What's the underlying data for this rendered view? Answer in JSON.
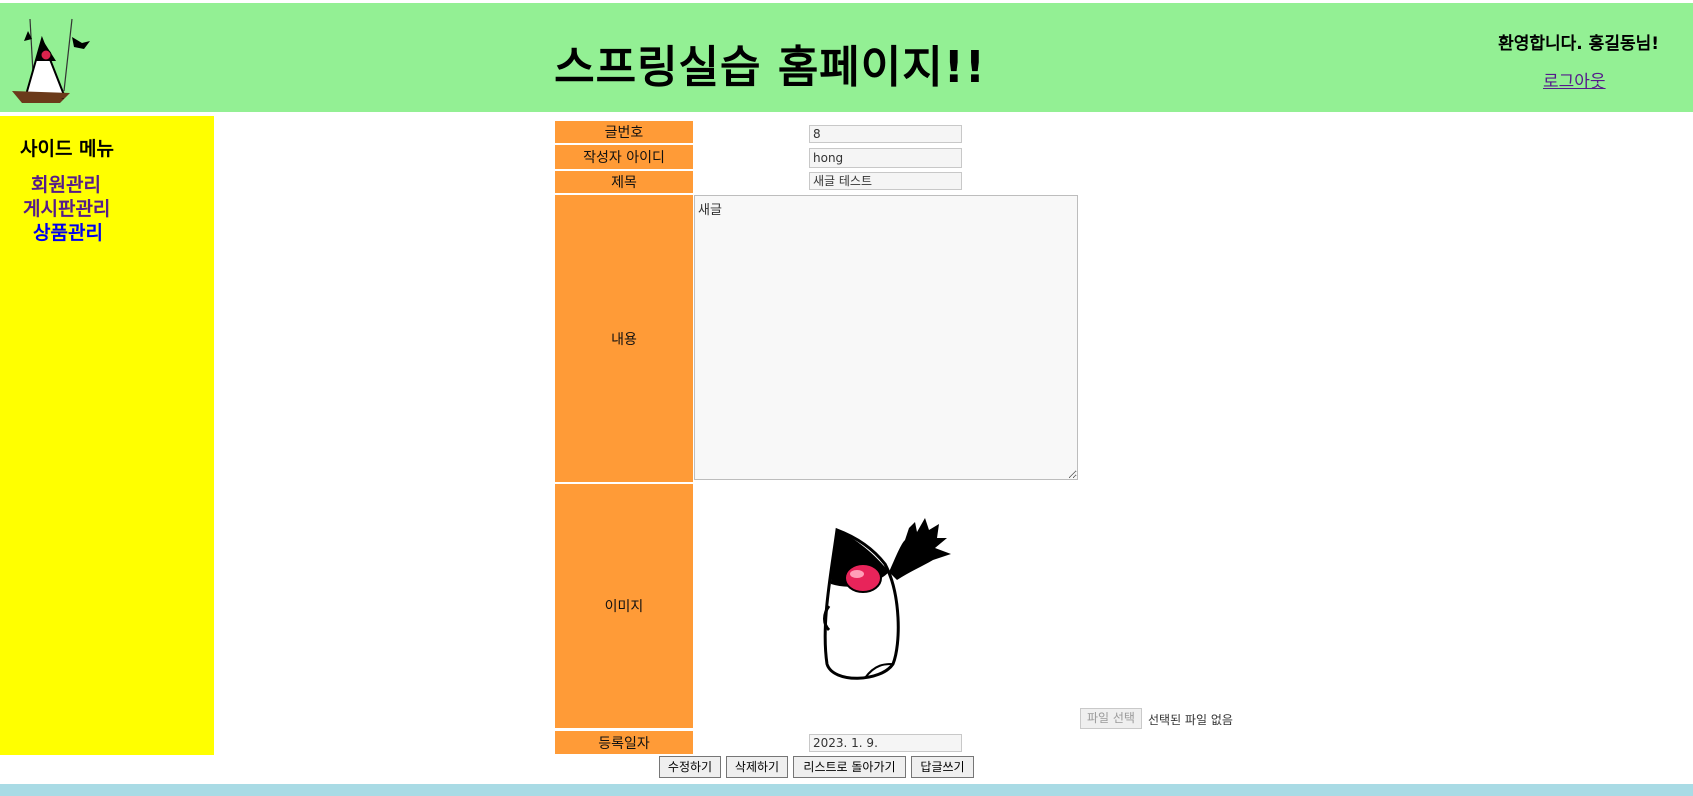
{
  "header": {
    "title": "스프링실습 홈페이지!!",
    "welcome": "환영합니다. 홍길동님!",
    "logout": "로그아웃",
    "logo_icon": "duke-swing-logo"
  },
  "sidebar": {
    "title": "사이드 메뉴",
    "items": [
      {
        "label": "회원관리"
      },
      {
        "label": "게시판관리"
      },
      {
        "label": "상품관리"
      }
    ]
  },
  "form": {
    "labels": {
      "article_no": "글번호",
      "writer_id": "작성자 아이디",
      "title": "제목",
      "content": "내용",
      "image": "이미지",
      "reg_date": "등록일자"
    },
    "values": {
      "article_no": "8",
      "writer_id": "hong",
      "title": "새글 테스트",
      "content": "새글",
      "reg_date": "2023. 1. 9."
    },
    "file_button": "파일 선택",
    "file_status": "선택된 파일 없음",
    "image_icon": "duke-waving-image"
  },
  "buttons": {
    "edit": "수정하기",
    "delete": "삭제하기",
    "back_to_list": "리스트로 돌아가기",
    "reply": "답글쓰기"
  },
  "colors": {
    "header_bg": "#93f094",
    "sidebar_bg": "#ffff00",
    "label_bg": "#ff9b37",
    "footer_bg": "#a9dbe5"
  }
}
